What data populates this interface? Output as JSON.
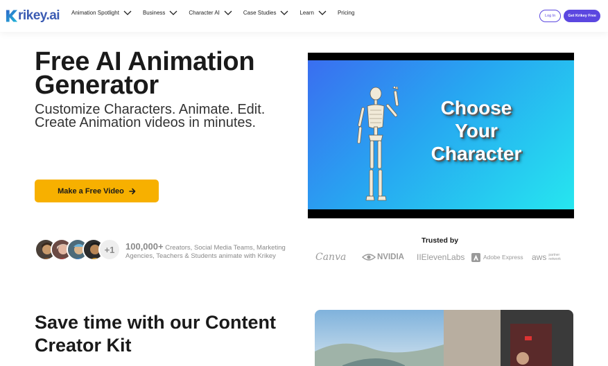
{
  "nav": {
    "logo_text": "rikey.ai",
    "items": [
      {
        "label": "Animation Spotlight",
        "has_dropdown": true
      },
      {
        "label": "Business",
        "has_dropdown": true
      },
      {
        "label": "Character AI",
        "has_dropdown": true
      },
      {
        "label": "Case Studies",
        "has_dropdown": true
      },
      {
        "label": "Learn",
        "has_dropdown": true
      },
      {
        "label": "Pricing",
        "has_dropdown": false
      }
    ],
    "login_label": "Log In",
    "get_free_label": "Get Krikey Free"
  },
  "hero": {
    "title": "Free AI Animation Generator",
    "subtitle": "Customize Characters. Animate. Edit. Create Animation videos in minutes.",
    "cta_label": "Make a Free Video"
  },
  "video": {
    "overlay_text": "Choose Your Character"
  },
  "social": {
    "avatar_extra": "+1",
    "count": "100,000+",
    "text": " Creators, Social Media Teams, Marketing Agencies, Teachers & Students animate with Krikey"
  },
  "trusted": {
    "heading": "Trusted by",
    "brands": [
      "Canva",
      "NVIDIA",
      "IIElevenLabs",
      "Adobe Express",
      "aws"
    ],
    "aws_sub": "partner network"
  },
  "section2": {
    "title": "Save time with our Content Creator Kit"
  },
  "colors": {
    "accent": "#5b47e0",
    "cta": "#f7b000",
    "logo": "#3b5bb3"
  }
}
